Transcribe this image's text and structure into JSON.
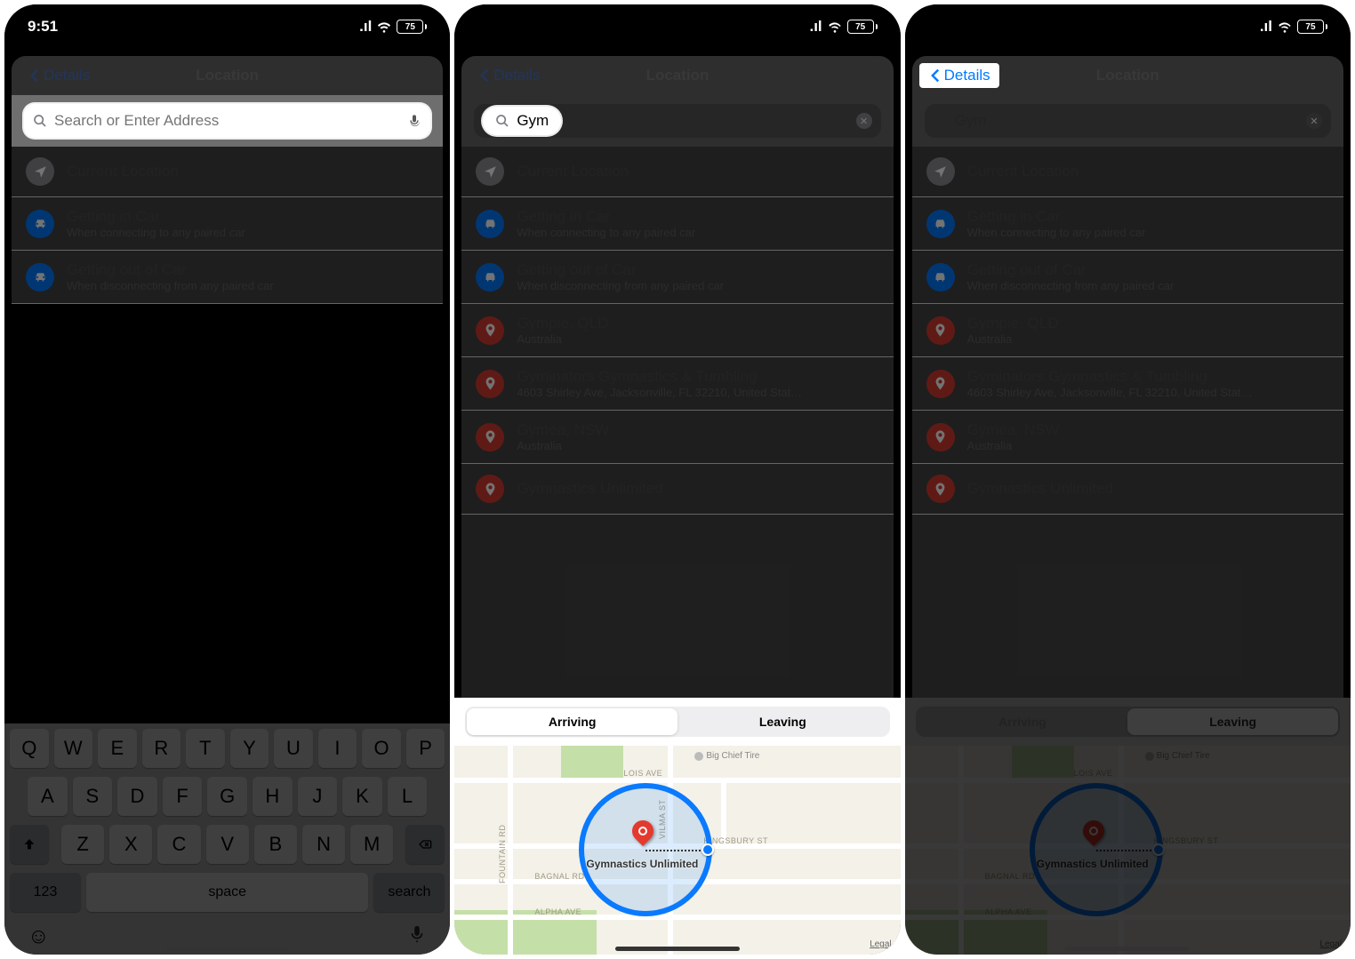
{
  "status": {
    "time": "9:51",
    "battery": "75"
  },
  "nav": {
    "back": "Details",
    "title": "Location"
  },
  "search": {
    "placeholder": "Search or Enter Address",
    "query": "Gym"
  },
  "base_rows": {
    "current": {
      "title": "Current Location"
    },
    "in_car": {
      "title": "Getting in Car",
      "sub": "When connecting to any paired car"
    },
    "out_car": {
      "title": "Getting out of Car",
      "sub": "When disconnecting from any paired car"
    }
  },
  "results": [
    {
      "title": "Gympie, QLD",
      "sub": "Australia"
    },
    {
      "title": "Gyminators Gymnastics & Tumbling",
      "sub": "4603 Shirley Ave, Jacksonville, FL  32210, United Stat…"
    },
    {
      "title": "Gymea, NSW",
      "sub": "Australia"
    },
    {
      "title": "Gymnastics Unlimited",
      "sub": ""
    }
  ],
  "segments": {
    "arriving": "Arriving",
    "leaving": "Leaving"
  },
  "map": {
    "place_label": "Gymnastics Unlimited",
    "legal": "Legal",
    "poi": "Big Chief Tire",
    "streets": {
      "lois": "LOIS AVE",
      "kingsbury": "KINGSBURY ST",
      "bagnal": "BAGNAL RD",
      "alpha": "ALPHA AVE",
      "fountain": "FOUNTAIN RD",
      "vilma": "VILMA ST"
    }
  },
  "keyboard": {
    "r1": [
      "Q",
      "W",
      "E",
      "R",
      "T",
      "Y",
      "U",
      "I",
      "O",
      "P"
    ],
    "r2": [
      "A",
      "S",
      "D",
      "F",
      "G",
      "H",
      "J",
      "K",
      "L"
    ],
    "r3": [
      "Z",
      "X",
      "C",
      "V",
      "B",
      "N",
      "M"
    ],
    "k123": "123",
    "space": "space",
    "search": "search"
  }
}
